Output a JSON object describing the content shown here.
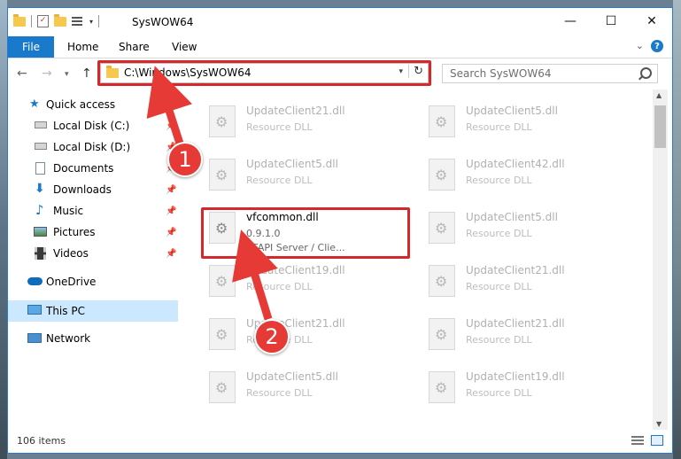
{
  "window": {
    "title": "SysWOW64",
    "controls": {
      "minimize": "—",
      "maximize": "☐",
      "close": "✕"
    }
  },
  "ribbon": {
    "tabs": [
      "File",
      "Home",
      "Share",
      "View"
    ],
    "help": "?"
  },
  "address": {
    "path": "C:\\Windows\\SysWOW64",
    "search_placeholder": "Search SysWOW64"
  },
  "sidebar": {
    "items": [
      {
        "label": "Quick access",
        "icon": "star-icon"
      },
      {
        "label": "Local Disk (C:)",
        "icon": "drive-icon",
        "pinned": true
      },
      {
        "label": "Local Disk (D:)",
        "icon": "drive-icon",
        "pinned": true
      },
      {
        "label": "Documents",
        "icon": "documents-icon",
        "pinned": true
      },
      {
        "label": "Downloads",
        "icon": "download-icon",
        "pinned": true
      },
      {
        "label": "Music",
        "icon": "music-icon",
        "pinned": true
      },
      {
        "label": "Pictures",
        "icon": "pictures-icon",
        "pinned": true
      },
      {
        "label": "Videos",
        "icon": "videos-icon",
        "pinned": true
      },
      {
        "label": "OneDrive",
        "icon": "cloud-icon"
      },
      {
        "label": "This PC",
        "icon": "pc-icon",
        "selected": true
      },
      {
        "label": "Network",
        "icon": "network-icon"
      }
    ]
  },
  "files": {
    "left": [
      {
        "name": "UpdateClient21.dll",
        "type": "Resource DLL"
      },
      {
        "name": "UpdateClient5.dll",
        "type": "Resource DLL"
      },
      {
        "name": "vfcommon.dll",
        "version": "0.9.1.0",
        "description": "VFAPI Server / Clie..."
      },
      {
        "name": "UpdateClient19.dll",
        "type": "Resource DLL"
      },
      {
        "name": "UpdateClient21.dll",
        "type": "Resource DLL"
      },
      {
        "name": "UpdateClient5.dll",
        "type": "Resource DLL"
      }
    ],
    "right": [
      {
        "name": "UpdateClient5.dll",
        "type": "Resource DLL"
      },
      {
        "name": "UpdateClient42.dll",
        "type": "Resource DLL"
      },
      {
        "name": "UpdateClient5.dll",
        "type": "Resource DLL"
      },
      {
        "name": "UpdateClient21.dll",
        "type": "Resource DLL"
      },
      {
        "name": "UpdateClient21.dll",
        "type": "Resource DLL"
      },
      {
        "name": "UpdateClient19.dll",
        "type": "Resource DLL"
      }
    ]
  },
  "status": {
    "items": "106 items"
  },
  "callouts": [
    "1",
    "2"
  ],
  "colors": {
    "accent": "#1979ca",
    "highlight": "#d4282c",
    "arrow": "#e53a35",
    "selected": "#cce8ff"
  }
}
